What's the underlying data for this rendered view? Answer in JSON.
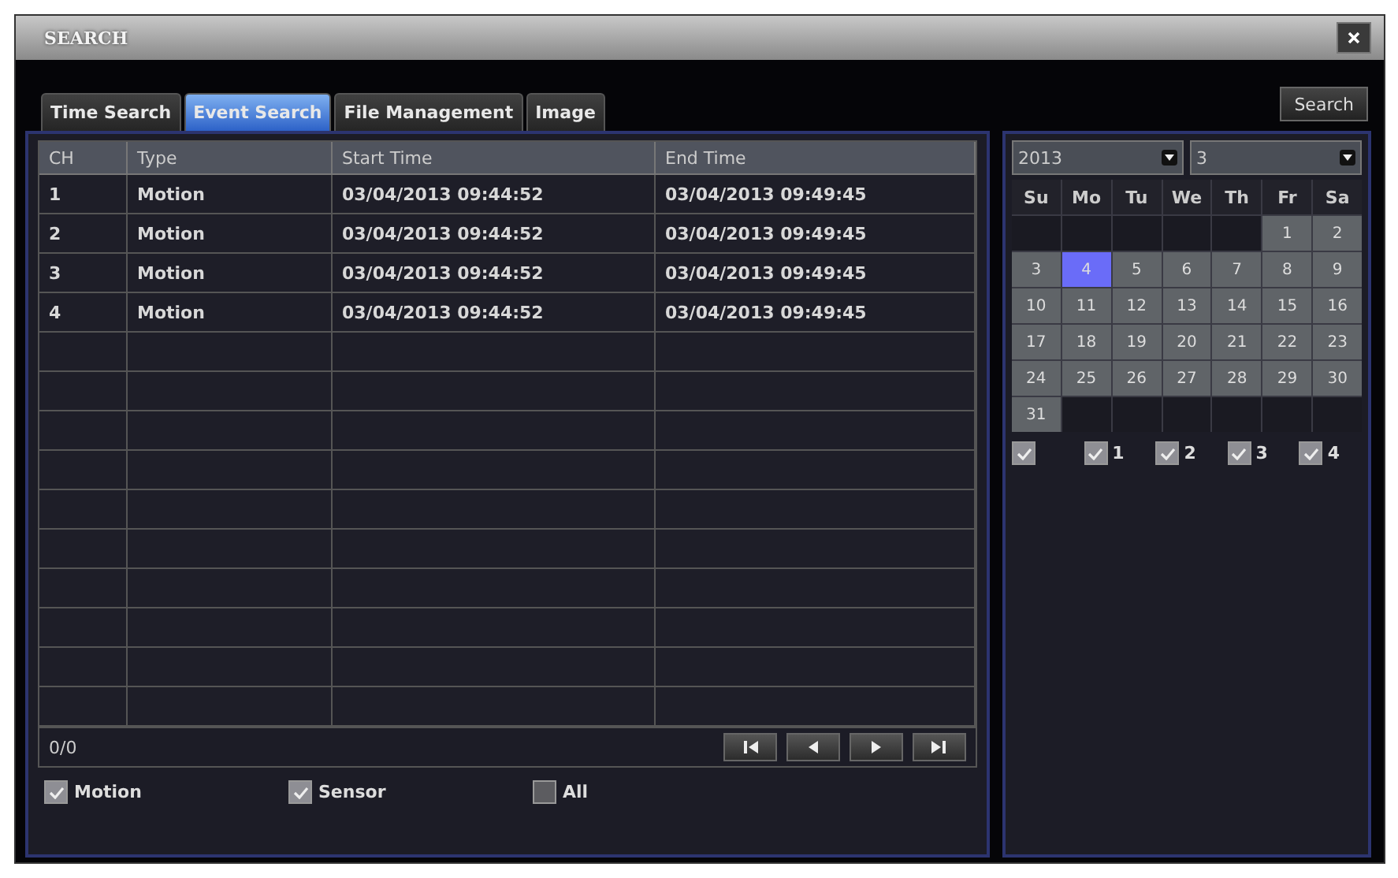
{
  "window": {
    "title": "SEARCH"
  },
  "tabs": [
    {
      "label": "Time Search",
      "selected": false
    },
    {
      "label": "Event Search",
      "selected": true
    },
    {
      "label": "File Management",
      "selected": false
    },
    {
      "label": "Image",
      "selected": false
    }
  ],
  "search_button": "Search",
  "table": {
    "columns": [
      "CH",
      "Type",
      "Start Time",
      "End Time"
    ],
    "rows": [
      [
        "1",
        "Motion",
        "03/04/2013 09:44:52",
        "03/04/2013 09:49:45"
      ],
      [
        "2",
        "Motion",
        "03/04/2013 09:44:52",
        "03/04/2013 09:49:45"
      ],
      [
        "3",
        "Motion",
        "03/04/2013 09:44:52",
        "03/04/2013 09:49:45"
      ],
      [
        "4",
        "Motion",
        "03/04/2013 09:44:52",
        "03/04/2013 09:49:45"
      ]
    ]
  },
  "page_indicator": "0/0",
  "event_filters": [
    {
      "label": "Motion",
      "checked": true
    },
    {
      "label": "Sensor",
      "checked": true
    },
    {
      "label": "All",
      "checked": false
    }
  ],
  "calendar": {
    "year": "2013",
    "month": "3",
    "weekdays": [
      "Su",
      "Mo",
      "Tu",
      "We",
      "Th",
      "Fr",
      "Sa"
    ],
    "weeks": [
      [
        {
          "kind": "blank"
        },
        {
          "kind": "blank"
        },
        {
          "kind": "blank"
        },
        {
          "kind": "blank"
        },
        {
          "kind": "blank"
        },
        {
          "label": "1",
          "selected": false
        },
        {
          "label": "2",
          "selected": false
        }
      ],
      [
        {
          "label": "3",
          "selected": false
        },
        {
          "label": "4",
          "selected": true
        },
        {
          "label": "5",
          "selected": false
        },
        {
          "label": "6",
          "selected": false
        },
        {
          "label": "7",
          "selected": false
        },
        {
          "label": "8",
          "selected": false
        },
        {
          "label": "9",
          "selected": false
        }
      ],
      [
        {
          "label": "10",
          "selected": false
        },
        {
          "label": "11",
          "selected": false
        },
        {
          "label": "12",
          "selected": false
        },
        {
          "label": "13",
          "selected": false
        },
        {
          "label": "14",
          "selected": false
        },
        {
          "label": "15",
          "selected": false
        },
        {
          "label": "16",
          "selected": false
        }
      ],
      [
        {
          "label": "17",
          "selected": false
        },
        {
          "label": "18",
          "selected": false
        },
        {
          "label": "19",
          "selected": false
        },
        {
          "label": "20",
          "selected": false
        },
        {
          "label": "21",
          "selected": false
        },
        {
          "label": "22",
          "selected": false
        },
        {
          "label": "23",
          "selected": false
        }
      ],
      [
        {
          "label": "24",
          "selected": false
        },
        {
          "label": "25",
          "selected": false
        },
        {
          "label": "26",
          "selected": false
        },
        {
          "label": "27",
          "selected": false
        },
        {
          "label": "28",
          "selected": false
        },
        {
          "label": "29",
          "selected": false
        },
        {
          "label": "30",
          "selected": false
        }
      ],
      [
        {
          "label": "31",
          "selected": false
        },
        {
          "kind": "blank"
        },
        {
          "kind": "blank"
        },
        {
          "kind": "blank"
        },
        {
          "kind": "blank"
        },
        {
          "kind": "blank"
        },
        {
          "kind": "blank"
        }
      ]
    ],
    "channels": [
      {
        "checked": true
      },
      {
        "label": "1",
        "checked": true
      },
      {
        "label": "2",
        "checked": true
      },
      {
        "label": "3",
        "checked": true
      },
      {
        "label": "4",
        "checked": true
      }
    ]
  }
}
